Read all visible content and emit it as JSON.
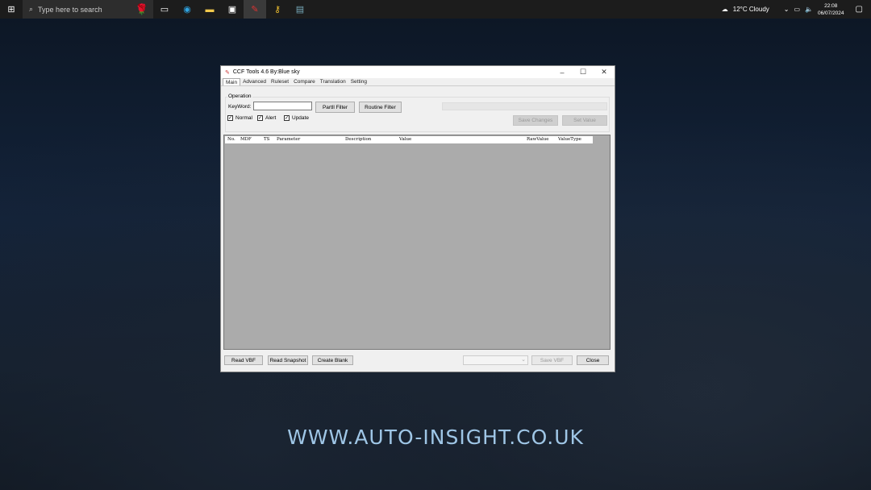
{
  "taskbar": {
    "search_placeholder": "Type here to search",
    "weather": "12°C  Cloudy",
    "time": "22:08",
    "date": "06/07/2024"
  },
  "window": {
    "title": "CCF Tools 4.6   By:Blue sky",
    "tabs": [
      "Main",
      "Advanced",
      "Ruleset",
      "Compare",
      "Translation",
      "Setting"
    ],
    "operation_label": "Operation",
    "keyword_label": "KeyWord:",
    "keyword_value": "",
    "partll_filter": "Partll Filter",
    "routine_filter": "Routine Filter",
    "checkboxes": [
      {
        "label": "Normal",
        "checked": true
      },
      {
        "label": "Alert",
        "checked": true
      },
      {
        "label": "Update",
        "checked": true
      }
    ],
    "save_changes": "Save Changes",
    "set_value": "Set Value",
    "columns": [
      "No.",
      "MDF",
      "TS",
      "Parameter",
      "Description",
      "Value",
      "RawValue",
      "ValueType"
    ],
    "read_vbf": "Read VBF",
    "read_snapshot": "Read Snapshot",
    "create_blank": "Create Blank",
    "save_vbf": "Save VBF",
    "close": "Close"
  },
  "watermark": "WWW.AUTO-INSIGHT.CO.UK"
}
